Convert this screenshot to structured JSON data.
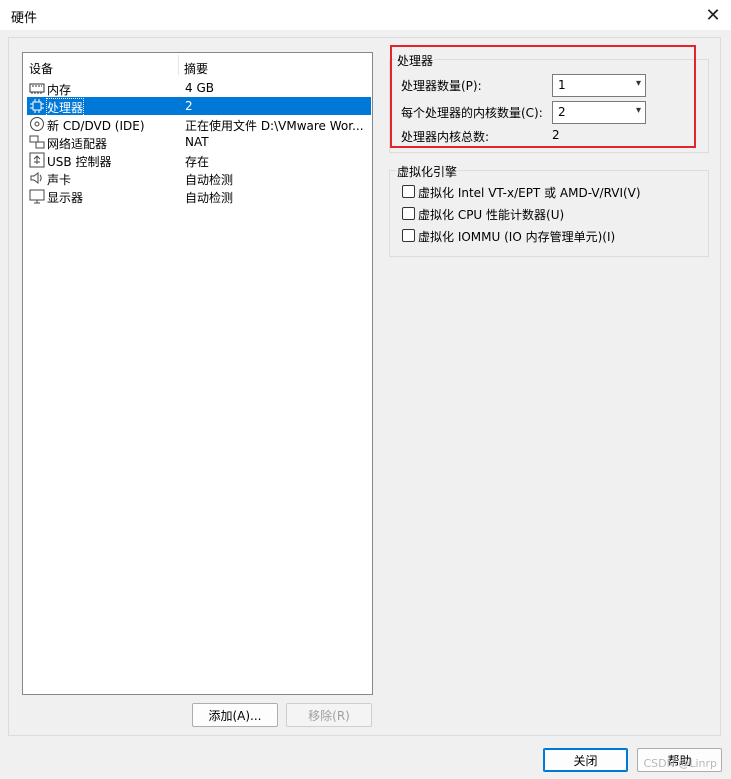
{
  "window": {
    "title": "硬件",
    "close_glyph": "✕"
  },
  "devices": {
    "columns": {
      "device": "设备",
      "summary": "摘要"
    },
    "items": [
      {
        "icon": "memory-icon",
        "name": "内存",
        "summary": "4 GB",
        "selected": false
      },
      {
        "icon": "processor-icon",
        "name": "处理器",
        "summary": "2",
        "selected": true
      },
      {
        "icon": "cd-dvd-icon",
        "name": "新 CD/DVD (IDE)",
        "summary": "正在使用文件 D:\\VMware Wor...",
        "selected": false
      },
      {
        "icon": "network-adapter-icon",
        "name": "网络适配器",
        "summary": "NAT",
        "selected": false
      },
      {
        "icon": "usb-icon",
        "name": "USB 控制器",
        "summary": "存在",
        "selected": false
      },
      {
        "icon": "sound-card-icon",
        "name": "声卡",
        "summary": "自动检测",
        "selected": false
      },
      {
        "icon": "display-icon",
        "name": "显示器",
        "summary": "自动检测",
        "selected": false
      }
    ],
    "add_button": "添加(A)...",
    "remove_button": "移除(R)"
  },
  "processor": {
    "group_title": "处理器",
    "count_label": "处理器数量(P):",
    "count_value": "1",
    "cores_label": "每个处理器的内核数量(C):",
    "cores_value": "2",
    "total_label": "处理器内核总数:",
    "total_value": "2"
  },
  "virtualization": {
    "group_title": "虚拟化引擎",
    "options": [
      {
        "label": "虚拟化 Intel VT-x/EPT 或 AMD-V/RVI(V)",
        "checked": false
      },
      {
        "label": "虚拟化 CPU 性能计数器(U)",
        "checked": false
      },
      {
        "label": "虚拟化 IOMMU (IO 内存管理单元)(I)",
        "checked": false
      }
    ]
  },
  "footer": {
    "close_button": "关闭",
    "help_button": "帮助",
    "watermark": "CSDN @Linrp"
  },
  "colors": {
    "selection": "#0078d7",
    "highlight_box": "#e3242b"
  }
}
